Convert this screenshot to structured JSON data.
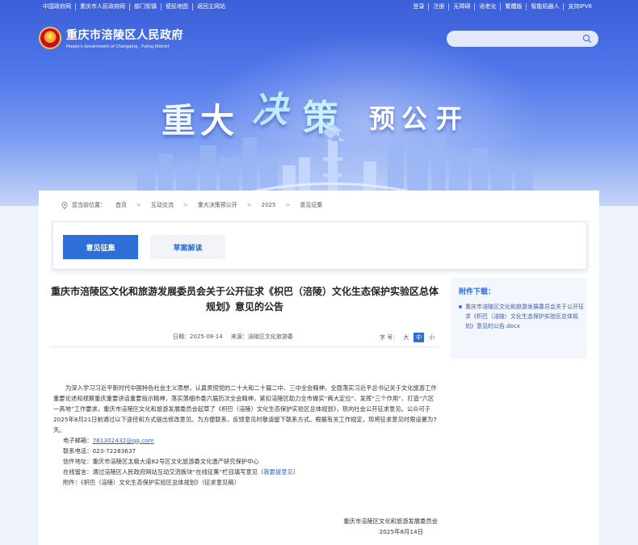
{
  "topbar": {
    "left_links": [
      "中国政府网",
      "重庆市人民政府网",
      "部门街镇",
      "便民地图",
      "返回主网站"
    ],
    "right_links": [
      "登录",
      "注册",
      "无障碍",
      "适老化",
      "繁體版",
      "智能机器人",
      "支持IPV6"
    ]
  },
  "header": {
    "site_name": "重庆市涪陵区人民政府",
    "site_name_en": "People's Government of Chongqing , Fuling District",
    "search_placeholder": ""
  },
  "banner": {
    "chars": [
      "重",
      "大",
      "决",
      "策",
      "预",
      "公",
      "开"
    ]
  },
  "breadcrumb": {
    "label": "您当前位置：",
    "items": [
      "首页",
      "互动交流",
      "重大决策预公开",
      "2025",
      "意见征集"
    ]
  },
  "tabs": [
    "意见征集",
    "草案解读"
  ],
  "article": {
    "title": "重庆市涪陵区文化和旅游发展委员会关于公开征求《枳巴（涪陵）文化生态保护实验区总体规划》意见的公告",
    "date": "日期：2025-08-14",
    "source": "来源：涪陵区文化旅游委",
    "font_label": "字 号：",
    "font_options": [
      "大",
      "中",
      "小"
    ],
    "font_selected": "中",
    "paragraph": "为深入学习习近平新时代中国特色社会主义思想，认真贯彻党的二十大和二十届二中、三中全会精神，全面落实习近平总书记关于文化旅游工作重要论述和视察重庆重要讲话重要指示精神，落实落细市委六届历次全会精神，紧扣涪陵区助力全市做实“两大定位”、发挥“三个作用”、打造“六区一高地”工作要求，重庆市涪陵区文化和旅游发展委员会起草了《枳巴（涪陵）文化生态保护实验区总体规划》，现向社会公开征求意见。公众可于2025年8月21日前通过以下途径和方式提出修改意见。为方便联系，反馈意见时敬请留下联系方式。根据有关工作规定，现将征求意见时限设置为7天。",
    "email_label": "电子邮箱：",
    "email": "761302432@qq.com",
    "phone": "联系电话：023-72283637",
    "address": "信件地址：重庆市涪陵区太极大道82号区文化旅游委文化遗产研究保护中心",
    "online_prefix": "在线留言：通过涪陵区人民政府网站互动交流板块“在线征集”栏目填写意见（",
    "online_link": "我要提意见",
    "online_suffix": "）",
    "attachment": "附件：《枳巴（涪陵）文化生态保护实验区总体规划》（征求意见稿）",
    "sign_org": "重庆市涪陵区文化和旅游发展委员会",
    "sign_date": "2025年8月14日"
  },
  "sidebar": {
    "title": "附件下载：",
    "file": "重庆市涪陵区文化和旅游发展委员会关于公开征求《枳巴（涪陵）文化生态保护实验区总体规划》意见的公告.docx"
  },
  "colors": {
    "primary": "#2e6ed8",
    "banner_top": "#3a5fd8",
    "banner_bottom": "#c7d6f8"
  }
}
